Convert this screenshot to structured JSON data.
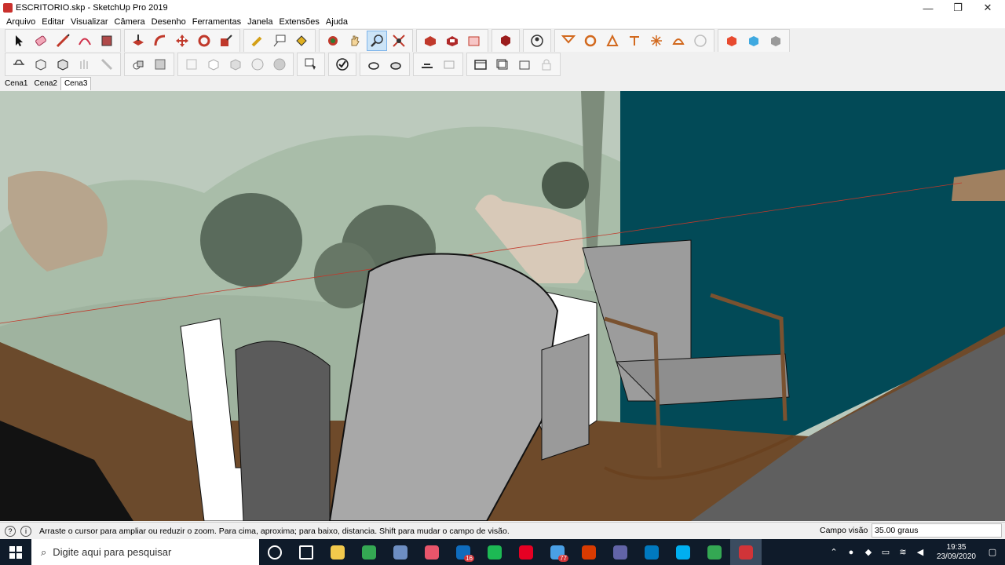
{
  "window": {
    "title": "ESCRITORIO.skp - SketchUp Pro 2019",
    "minimize_glyph": "—",
    "maximize_glyph": "❐",
    "close_glyph": "✕"
  },
  "menu": [
    "Arquivo",
    "Editar",
    "Visualizar",
    "Câmera",
    "Desenho",
    "Ferramentas",
    "Janela",
    "Extensões",
    "Ajuda"
  ],
  "toolbar1": {
    "tools": [
      "select-tool-icon",
      "eraser-tool-icon",
      "line-tool-icon",
      "arc-tool-icon",
      "shape-tool-icon",
      "push-pull-tool-icon",
      "follow-me-tool-icon",
      "move-tool-icon",
      "rotate-tool-icon",
      "scale-tool-icon",
      "tape-measure-tool-icon",
      "text-tool-icon",
      "paint-bucket-tool-icon",
      "orbit-tool-icon",
      "pan-tool-icon",
      "zoom-tool-icon",
      "zoom-extents-tool-icon",
      "3d-warehouse-icon",
      "extension-warehouse-icon",
      "layout-icon",
      "extension-manager-icon",
      "account-icon",
      "sandbox-tools-icon",
      "ruby-icon",
      "solid-tools-icon"
    ]
  },
  "toolbar2": {
    "tools": [
      "section-plane-icon",
      "views-iso-icon",
      "views-top-icon",
      "views-front-icon",
      "views-right-icon",
      "styles-xray-icon",
      "styles-backedges-icon",
      "styles-wireframe-icon",
      "styles-hidden-line-icon",
      "styles-shaded-icon",
      "styles-textured-icon",
      "styles-monochrome-icon",
      "components-icon",
      "check-icon",
      "teapot-icon",
      "shadows-icon",
      "fog-icon",
      "camera-icon"
    ]
  },
  "scenes": [
    "Cena1",
    "Cena2",
    "Cena3"
  ],
  "active_scene": "Cena3",
  "status": {
    "message": "Arraste o cursor para ampliar ou reduzir o zoom. Para cima, aproxima; para baixo, distancia. Shift para mudar o campo de visão.",
    "vcb_label": "Campo visão",
    "vcb_value": "35.00 graus"
  },
  "taskbar": {
    "search_placeholder": "Digite aqui para pesquisar",
    "apps": [
      {
        "name": "cortana-icon",
        "color": "#ffffff"
      },
      {
        "name": "task-view-icon",
        "color": "#ffffff"
      },
      {
        "name": "file-explorer-icon",
        "color": "#f2c94c"
      },
      {
        "name": "chrome-icon",
        "color": "#34a853"
      },
      {
        "name": "calculator-icon",
        "color": "#6d8ec2"
      },
      {
        "name": "colorful-app-icon",
        "color": "#e8556b"
      },
      {
        "name": "outlook-icon",
        "color": "#0f6cbd",
        "badge": "16"
      },
      {
        "name": "spotify-icon",
        "color": "#1db954"
      },
      {
        "name": "pinterest-icon",
        "color": "#e60023"
      },
      {
        "name": "mail-icon",
        "color": "#4aa0e6",
        "badge": "77"
      },
      {
        "name": "office-icon",
        "color": "#d83b01"
      },
      {
        "name": "teams-icon",
        "color": "#6264a7"
      },
      {
        "name": "trello-icon",
        "color": "#0079bf"
      },
      {
        "name": "skype-icon",
        "color": "#00aff0"
      },
      {
        "name": "chrome-icon-2",
        "color": "#34a853"
      },
      {
        "name": "sketchup-icon",
        "color": "#d13438",
        "active": true
      }
    ],
    "time": "19:35",
    "date": "23/09/2020"
  },
  "colors": {
    "accent_wall": "#024a57",
    "wallpaper": "#b8c8bc",
    "floor": "#6e4a2a",
    "chair_gray": "#a8a8a8"
  }
}
